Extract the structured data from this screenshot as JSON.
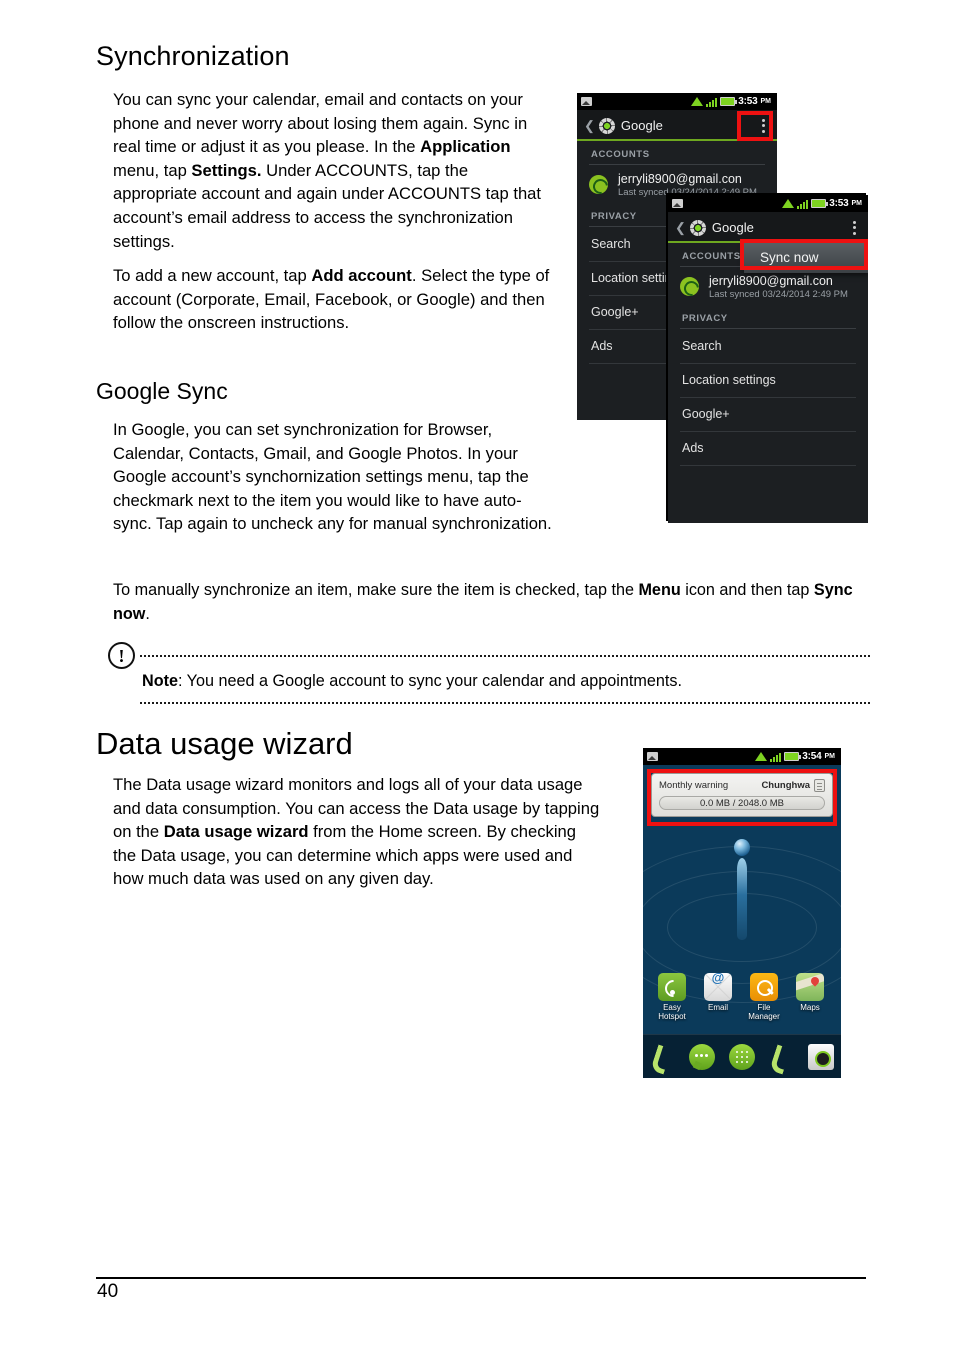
{
  "document": {
    "page_number": "40"
  },
  "sections": {
    "synchronization": {
      "title": "Synchronization",
      "paragraph_1": {
        "part_1": "You can sync your calendar, email and contacts on your phone and never worry about losing them again. Sync in real time or adjust it as you please. In the ",
        "bold_1": "Application",
        "part_2": " menu, tap ",
        "bold_2": "Settings.",
        "part_3": " Under ACCOUNTS, tap the appropriate account and again under ACCOUNTS tap that account’s email address to access the synchronization settings."
      },
      "paragraph_2": {
        "part_1": "To add a new account, tap ",
        "bold_1": "Add account",
        "part_2": ". Select the type of account (Corporate, Email, Facebook, or Google) and then follow the onscreen instructions."
      }
    },
    "google_sync": {
      "title": "Google Sync",
      "paragraph_1": "In Google, you can set synchronization for Browser, Calendar, Contacts, Gmail, and Google Photos. In your Google account’s synchornization settings menu, tap the checkmark next to the item you would like to have auto-sync. Tap again to uncheck any for manual synchronization.",
      "paragraph_2": {
        "part_1": "To manually synchronize an item, make sure the item is checked, tap the ",
        "bold_1": "Menu",
        "part_2": " icon and then tap ",
        "bold_2": "Sync now",
        "part_3": "."
      }
    },
    "note": {
      "icon": "exclamation-circle-icon",
      "glyph": "!",
      "label": "Note",
      "text": ": You need a Google account to sync your calendar and appointments."
    },
    "data_usage_wizard": {
      "title": "Data usage wizard",
      "paragraph_1": {
        "part_1": "The Data usage wizard monitors and logs all of your data usage and data consumption. You can access the Data usage by tapping on the ",
        "bold_1": "Data usage wizard",
        "part_2": " from the Home screen. By checking the Data usage, you can determine which apps were used and how much data was used on any given day."
      }
    }
  },
  "screenshots": {
    "phone_google_settings": {
      "status_bar": {
        "time": "3:53",
        "ampm": "PM"
      },
      "action_bar": {
        "title": "Google"
      },
      "accounts_header": "ACCOUNTS",
      "account": {
        "email": "jerryli8900@gmail.con",
        "last_synced": "Last synced 03/24/2014 2:49 PM"
      },
      "privacy_header": "PRIVACY",
      "rows": [
        "Search",
        "Location settin",
        "Google+",
        "Ads"
      ],
      "highlight": "menu-overflow-highlight"
    },
    "phone_sync_now": {
      "status_bar": {
        "time": "3:53",
        "ampm": "PM"
      },
      "action_bar": {
        "title": "Google"
      },
      "accounts_header": "ACCOUNTS",
      "popup_item": "Sync now",
      "account": {
        "email": "jerryli8900@gmail.con",
        "last_synced": "Last synced 03/24/2014 2:49 PM"
      },
      "privacy_header": "PRIVACY",
      "rows": [
        "Search",
        "Location settings",
        "Google+",
        "Ads"
      ],
      "highlight": "sync-now-highlight"
    },
    "phone_home_data_usage": {
      "status_bar": {
        "time": "3:54",
        "ampm": "PM"
      },
      "widget": {
        "title": "Monthly warning",
        "carrier": "Chunghwa",
        "usage": "0.0 MB / 2048.0 MB"
      },
      "apps": [
        {
          "label": "Easy Hotspot",
          "icon": "hotspot-icon"
        },
        {
          "label": "Email",
          "icon": "email-icon"
        },
        {
          "label": "File Manager",
          "icon": "file-manager-icon"
        },
        {
          "label": "Maps",
          "icon": "maps-icon"
        }
      ],
      "dock": [
        {
          "icon": "phone-icon"
        },
        {
          "icon": "messaging-icon"
        },
        {
          "icon": "app-drawer-icon"
        },
        {
          "icon": "phone-icon"
        },
        {
          "icon": "camera-icon"
        }
      ]
    }
  },
  "colors": {
    "highlight_red": "#ee1111",
    "android_green": "#7ed321",
    "action_bar_underline": "#6ea820"
  }
}
